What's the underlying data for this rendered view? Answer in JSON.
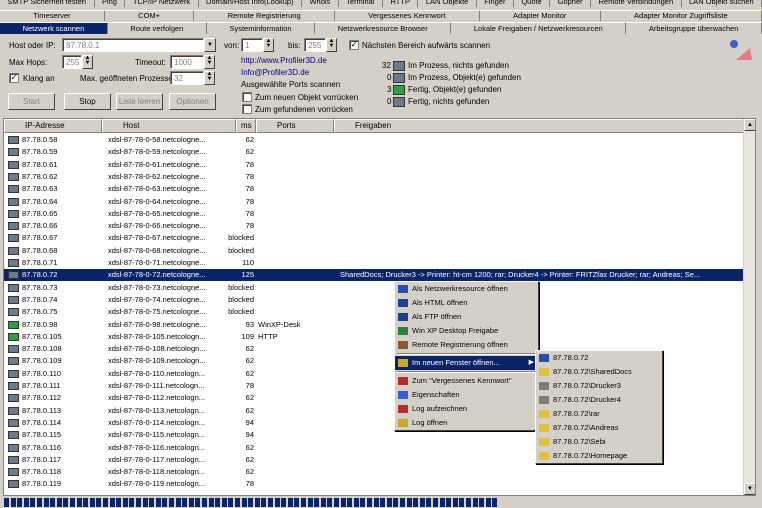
{
  "tabs_row1": [
    "SMTP Sicherheit testen",
    "Ping",
    "TCP/IP Netzwerk",
    "Domain/Host Info(Lookup)",
    "Whois",
    "Terminal",
    "HTTP",
    "LAN Objekte",
    "Finger",
    "Quote",
    "Gopher",
    "Remote Verbindungen",
    "LAN Objekt suchen"
  ],
  "tabs_row2": [
    "Timeserver",
    "COM+",
    "Remote Registrierung",
    "Vergessenes Kennwort",
    "Adapter Monitor",
    "Adapter Monitor Zugriffsliste"
  ],
  "tabs_row3": [
    "Netzwerk scannen",
    "Route verfolgen",
    "Systeminformation",
    "Netzwerkresource Browser",
    "Lokale Freigaben / Netzwerkresourcen",
    "Arbeitsgruppe überwachen"
  ],
  "form": {
    "host_label": "Host oder IP:",
    "host_value": "87.78.0.1",
    "von_label": "von:",
    "von_value": "1",
    "bis_label": "bis:",
    "bis_value": "255",
    "next_range_label": "Nächsten Bereich aufwärts scannen",
    "maxhops_label": "Max Hops:",
    "maxhops_value": "255",
    "timeout_label": "Timeout:",
    "timeout_value": "1000",
    "klang_label": "Klang an",
    "max_proc_label": "Max. geöffneten Prozessen",
    "max_proc_value": "32",
    "link1": "http://www.Profiler3D.de",
    "link2": "Info@Profiler3D.de",
    "ports_label": "Ausgewählte Ports scannen",
    "opt_new": "Zum neuen Objekt vorrücken",
    "opt_found": "Zum gefundenen vorrücken"
  },
  "buttons": {
    "start": "Start",
    "stop": "Stop",
    "clear": "Liste leeren",
    "options": "Optionen"
  },
  "status_counts": [
    {
      "count": "32",
      "label": "Im Prozess, nichts gefunden"
    },
    {
      "count": "0",
      "label": "Im Prozess, Objekt(e) gefunden"
    },
    {
      "count": "3",
      "label": "Fertig, Objekt(e) gefunden"
    },
    {
      "count": "0",
      "label": "Fertig, nichts gefunden"
    }
  ],
  "columns": {
    "ip": "IP-Adresse",
    "host": "Host",
    "ms": "ms",
    "ports": "Ports",
    "shares": "Freigaben"
  },
  "rows": [
    {
      "ip": "87.78.0.58",
      "host": "xdsl-87-78-0-58.netcologne...",
      "ms": "62",
      "ports": "",
      "shares": ""
    },
    {
      "ip": "87.78.0.59",
      "host": "xdsl-87-78-0-59.netcologne...",
      "ms": "62",
      "ports": "",
      "shares": ""
    },
    {
      "ip": "87.78.0.61",
      "host": "xdsl-87-78-0-61.netcologne...",
      "ms": "78",
      "ports": "",
      "shares": ""
    },
    {
      "ip": "87.78.0.62",
      "host": "xdsl-87-78-0-62.netcologne...",
      "ms": "78",
      "ports": "",
      "shares": ""
    },
    {
      "ip": "87.78.0.63",
      "host": "xdsl-87-78-0-63.netcologne...",
      "ms": "78",
      "ports": "",
      "shares": ""
    },
    {
      "ip": "87.78.0.64",
      "host": "xdsl-87-78-0-64.netcologne...",
      "ms": "78",
      "ports": "",
      "shares": ""
    },
    {
      "ip": "87.78.0.65",
      "host": "xdsl-87-78-0-65.netcologne...",
      "ms": "78",
      "ports": "",
      "shares": ""
    },
    {
      "ip": "87.78.0.66",
      "host": "xdsl-87-78-0-66.netcologne...",
      "ms": "78",
      "ports": "",
      "shares": ""
    },
    {
      "ip": "87.78.0.67",
      "host": "xdsl-87-78-0-67.netcologne...",
      "ms": "blocked",
      "ports": "",
      "shares": ""
    },
    {
      "ip": "87.78.0.68",
      "host": "xdsl-87-78-0-68.netcologne...",
      "ms": "blocked",
      "ports": "",
      "shares": ""
    },
    {
      "ip": "87.78.0.71",
      "host": "xdsl-87-78-0-71.netcologne...",
      "ms": "110",
      "ports": "",
      "shares": ""
    },
    {
      "ip": "87.78.0.72",
      "host": "xdsl-87-78-0-72.netcologne...",
      "ms": "125",
      "ports": "",
      "shares": "SharedDocs; Drucker3 -> Printer: ht-cm 1200; rar; Drucker4 -> Printer: FRITZfax Drucker; rar; Andreas; Se..."
    },
    {
      "ip": "87.78.0.73",
      "host": "xdsl-87-78-0-73.netcologne...",
      "ms": "blocked",
      "ports": "",
      "shares": ""
    },
    {
      "ip": "87.78.0.74",
      "host": "xdsl-87-78-0-74.netcologne...",
      "ms": "blocked",
      "ports": "",
      "shares": ""
    },
    {
      "ip": "87.78.0.75",
      "host": "xdsl-87-78-0-75.netcologne...",
      "ms": "blocked",
      "ports": "",
      "shares": ""
    },
    {
      "ip": "87.78.0.98",
      "host": "xdsl-87-78-0-98.netcologne...",
      "ms": "93",
      "ports": "WinXP-Desk",
      "shares": ""
    },
    {
      "ip": "87.78.0.105",
      "host": "xdsl-87-78-0-105.netcologn...",
      "ms": "109",
      "ports": "HTTP",
      "shares": ""
    },
    {
      "ip": "87.78.0.108",
      "host": "xdsl-87-78-0-108.netcologn...",
      "ms": "62",
      "ports": "",
      "shares": ""
    },
    {
      "ip": "87.78.0.109",
      "host": "xdsl-87-78-0-109.netcologn...",
      "ms": "62",
      "ports": "",
      "shares": ""
    },
    {
      "ip": "87.78.0.110",
      "host": "xdsl-87-78-0-110.netcologn...",
      "ms": "62",
      "ports": "",
      "shares": ""
    },
    {
      "ip": "87.78.0.111",
      "host": "xdsl-87-78-0-111.netcologn...",
      "ms": "78",
      "ports": "",
      "shares": ""
    },
    {
      "ip": "87.78.0.112",
      "host": "xdsl-87-78-0-112.netcologn...",
      "ms": "62",
      "ports": "",
      "shares": ""
    },
    {
      "ip": "87.78.0.113",
      "host": "xdsl-87-78-0-113.netcologn...",
      "ms": "62",
      "ports": "",
      "shares": ""
    },
    {
      "ip": "87.78.0.114",
      "host": "xdsl-87-78-0-114.netcologn...",
      "ms": "94",
      "ports": "",
      "shares": ""
    },
    {
      "ip": "87.78.0.115",
      "host": "xdsl-87-78-0-115.netcologn...",
      "ms": "94",
      "ports": "",
      "shares": ""
    },
    {
      "ip": "87.78.0.116",
      "host": "xdsl-87-78-0-116.netcologn...",
      "ms": "62",
      "ports": "",
      "shares": ""
    },
    {
      "ip": "87.78.0.117",
      "host": "xdsl-87-78-0-117.netcologn...",
      "ms": "62",
      "ports": "",
      "shares": ""
    },
    {
      "ip": "87.78.0.118",
      "host": "xdsl-87-78-0-118.netcologn...",
      "ms": "62",
      "ports": "",
      "shares": ""
    },
    {
      "ip": "87.78.0.119",
      "host": "xdsl-87-78-0-119.netcologn...",
      "ms": "78",
      "ports": "",
      "shares": ""
    }
  ],
  "selected_row_index": 11,
  "context_menu": [
    "Als Netzwerkresource öffnen",
    "Als HTML öffnen",
    "Als FTP öffnen",
    "Win XP Desktop Freigabe",
    "Remote Registrierung öffnen",
    "Im neuen Fenster öffnen...",
    "Zum \"Vergessenes Kennwort\"",
    "Eigenschaften",
    "Log aufzeichnen",
    "Log öffnen"
  ],
  "submenu": [
    "87.78.0.72",
    "87.78.0.72\\SharedDocs",
    "87.78.0.72\\Drucker3",
    "87.78.0.72\\Drucker4",
    "87.78.0.72\\rar",
    "87.78.0.72\\Andreas",
    "87.78.0.72\\Sebi",
    "87.78.0.72\\Homepage"
  ],
  "colors": {
    "selection": "#0a246a",
    "face": "#d4d0c8",
    "link": "#00008b"
  }
}
